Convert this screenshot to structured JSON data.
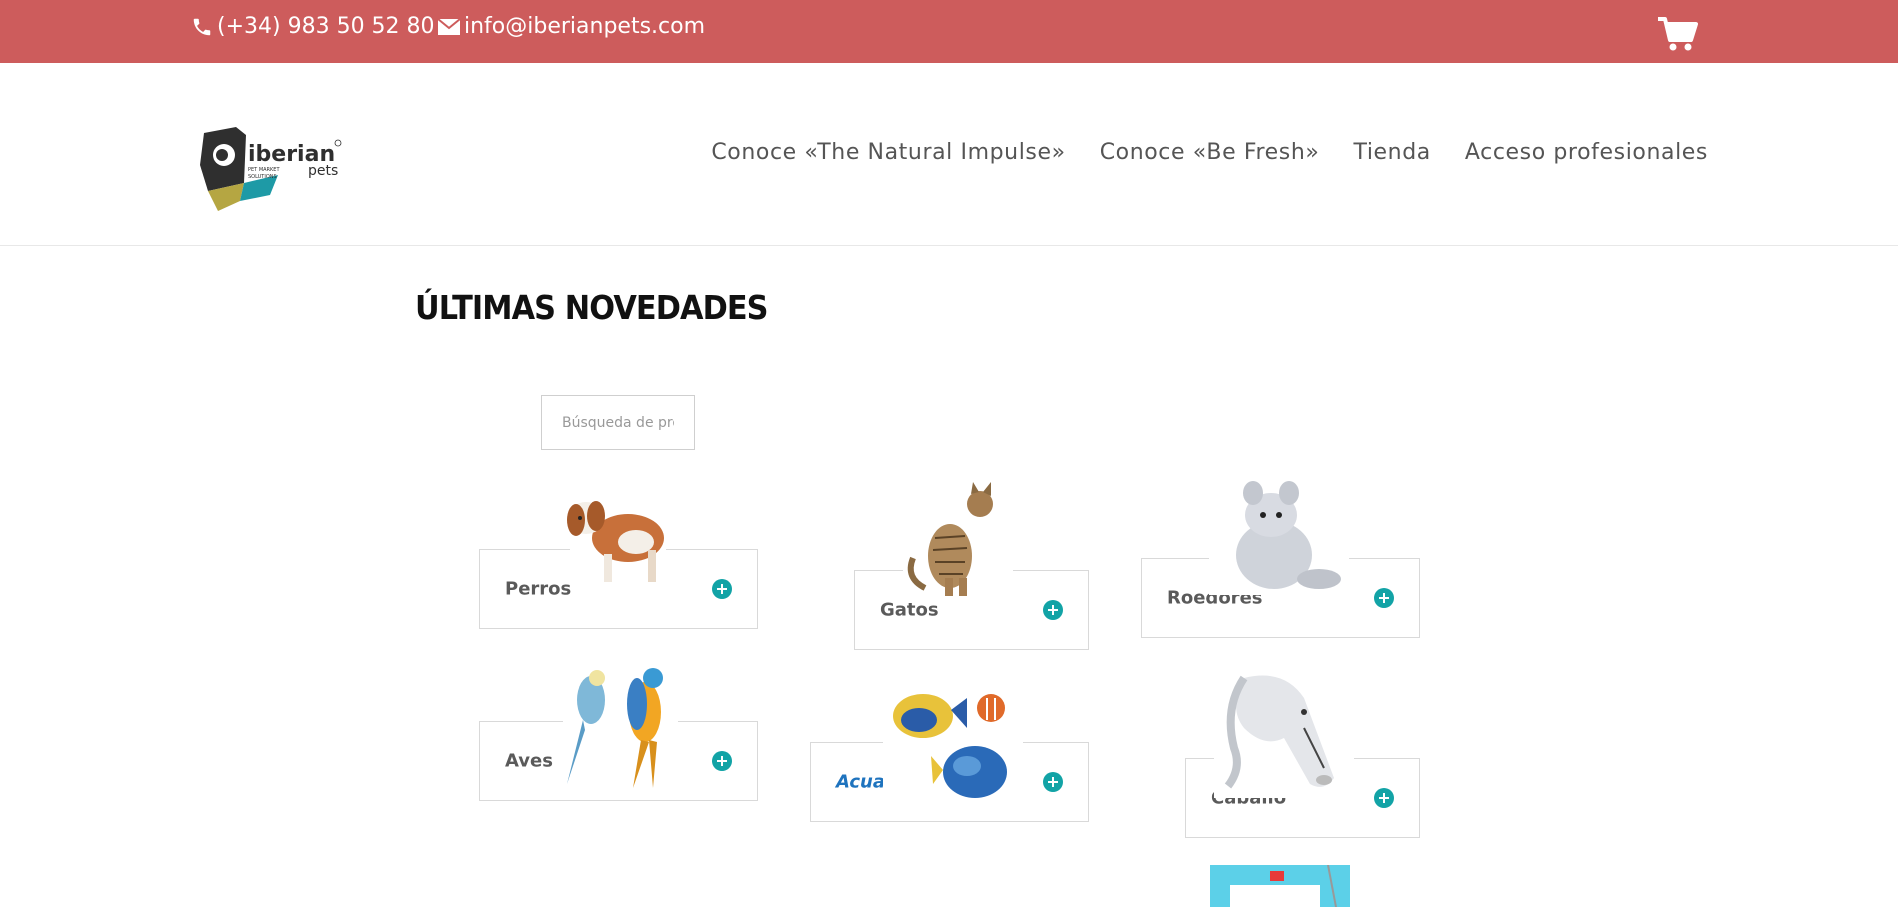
{
  "topbar": {
    "phone": "(+34) 983 50 52 80",
    "email": "info@iberianpets.com",
    "phone_icon": "phone-icon",
    "email_icon": "envelope-icon",
    "cart_icon": "shopping-cart-icon"
  },
  "header": {
    "logo": {
      "brand": "iberian",
      "sub": "pets",
      "tagline_1": "PET MARKET",
      "tagline_2": "SOLUTIONS"
    },
    "nav": [
      "Conoce «The Natural Impulse»",
      "Conoce «Be Fresh»",
      "Tienda",
      "Acceso profesionales"
    ]
  },
  "main": {
    "title": "ÚLTIMAS NOVEDADES",
    "search_placeholder": "Búsqueda de productos",
    "categories": [
      {
        "label": "Perros",
        "image": "dog-illustration"
      },
      {
        "label": "Gatos",
        "image": "cat-illustration"
      },
      {
        "label": "Roedores",
        "image": "chinchilla-illustration"
      },
      {
        "label": "Aves",
        "image": "parrots-illustration"
      },
      {
        "label": "Acuarofília",
        "image": "fish-illustration"
      },
      {
        "label": "Caballo",
        "image": "horse-illustration"
      }
    ]
  },
  "colors": {
    "topbar_bg": "#cd5c5c",
    "accent_teal": "#12a3a6",
    "link_blue": "#1e73be"
  }
}
